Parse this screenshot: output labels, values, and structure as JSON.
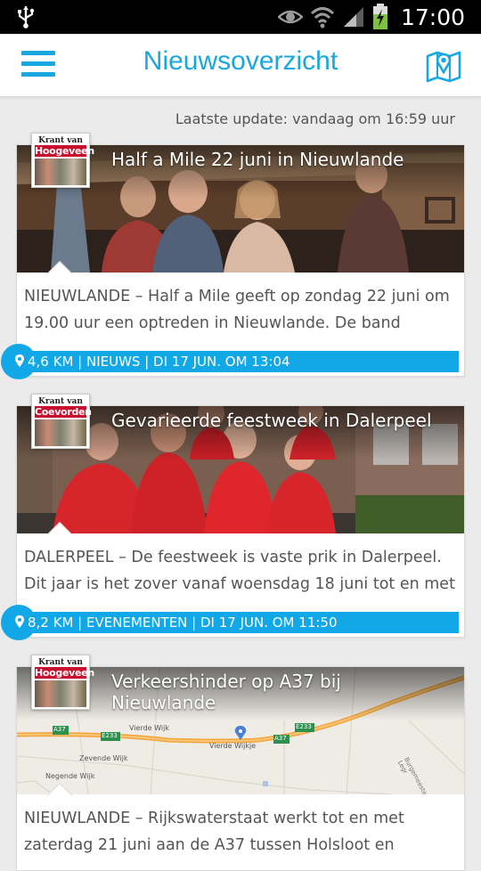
{
  "status": {
    "time": "17:00",
    "icons": [
      "usb-icon",
      "eye-icon",
      "wifi-icon",
      "signal-icon",
      "battery-charging-icon"
    ]
  },
  "header": {
    "title": "Nieuwsoverzicht",
    "menu_icon": "hamburger-menu-icon",
    "map_icon": "map-pin-icon",
    "accent": "#18a7e0"
  },
  "last_update": "Laatste update: vandaag om 16:59 uur",
  "articles": [
    {
      "source": {
        "top": "Krant van",
        "name": "Hoogeveen"
      },
      "title": "Half a Mile 22 juni in Nieuwlande",
      "image": "band-photo",
      "text": "NIEUWLANDE – Half a Mile geeft op zondag 22 juni om 19.00 uur een optreden in Nieuwlande. De band",
      "meta": "4,6 KM | NIEUWS | DI 17 JUN. OM 13:04"
    },
    {
      "source": {
        "top": "Krant van",
        "name": "Coevorden"
      },
      "title": "Gevarieerde feestweek in Dalerpeel",
      "image": "group-photo",
      "text": "DALERPEEL – De feestweek is vaste prik in Dalerpeel. Dit jaar is het zover vanaf woensdag 18 juni tot en met",
      "meta": "8,2 KM | EVENEMENTEN | DI 17 JUN. OM 11:50"
    },
    {
      "source": {
        "top": "Krant van",
        "name": "Hoogeveen"
      },
      "title": "Verkeershinder op A37 bij Nieuwlande",
      "image": "map",
      "map_labels": {
        "road1": "A37",
        "road2": "E233",
        "road3": "A37",
        "road4": "E233",
        "place1": "Vierde Wijk",
        "place2": "Vierde Wijkje",
        "place3": "Zevende Wijk",
        "place4": "Negende Wijk",
        "place5": "Burgemeester Legr"
      },
      "text": "NIEUWLANDE – Rijkswaterstaat werkt tot en met zaterdag 21 juni aan de A37 tussen Holsloot en",
      "meta": ""
    }
  ],
  "colors": {
    "meta_bar": "#12a8e8",
    "card_text": "#555555"
  }
}
